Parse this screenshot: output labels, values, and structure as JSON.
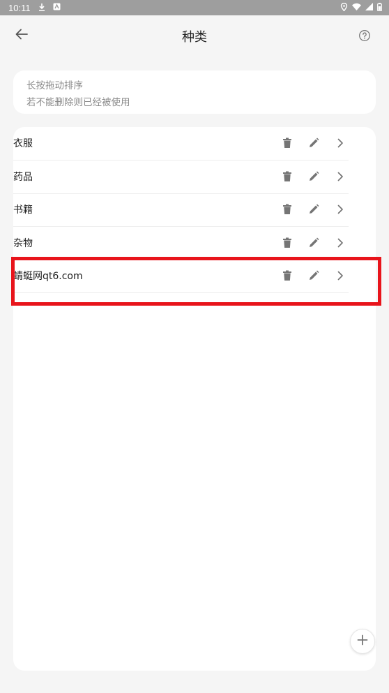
{
  "status_bar": {
    "time": "10:11"
  },
  "app_bar": {
    "title": "种类",
    "back_icon": "arrow-left-icon",
    "help_icon": "help-circle-icon"
  },
  "info": {
    "line1": "长按拖动排序",
    "line2": "若不能删除则已经被使用"
  },
  "categories": [
    {
      "label": "衣服"
    },
    {
      "label": "药品"
    },
    {
      "label": "书籍"
    },
    {
      "label": "杂物"
    },
    {
      "label": "蜻蜓网qt6.com"
    }
  ],
  "row_icons": [
    "trash-icon",
    "pencil-icon",
    "chevron-right-icon"
  ],
  "colors": {
    "background": "#f5f5f5",
    "card": "#ffffff",
    "icon": "#757575",
    "highlight": "#e8141b",
    "status_bar": "#9e9e9e"
  }
}
